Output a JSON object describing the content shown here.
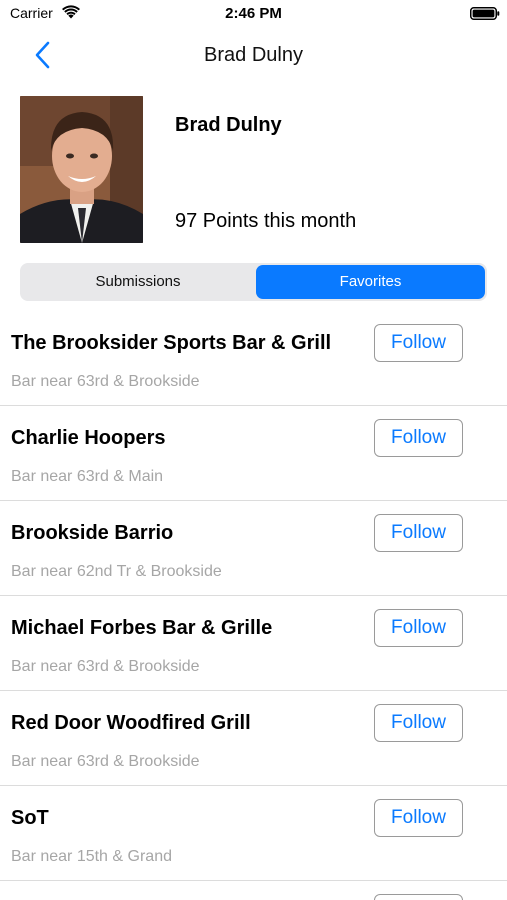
{
  "status_bar": {
    "carrier": "Carrier",
    "time": "2:46 PM"
  },
  "nav": {
    "title": "Brad Dulny"
  },
  "profile": {
    "name": "Brad Dulny",
    "points": "97 Points this month"
  },
  "segments": {
    "submissions": "Submissions",
    "favorites": "Favorites",
    "selected": "Favorites"
  },
  "colors": {
    "accent": "#0a7aff",
    "subtitle": "#a6a6a6",
    "divider": "#dcdcdc"
  },
  "favorites": [
    {
      "title": "The Brooksider Sports Bar & Grill",
      "subtitle": "Bar near 63rd & Brookside",
      "button": "Follow"
    },
    {
      "title": "Charlie Hoopers",
      "subtitle": "Bar near 63rd & Main",
      "button": "Follow"
    },
    {
      "title": "Brookside Barrio",
      "subtitle": "Bar near 62nd Tr & Brookside",
      "button": "Follow"
    },
    {
      "title": "Michael Forbes Bar & Grille",
      "subtitle": "Bar near 63rd & Brookside",
      "button": "Follow"
    },
    {
      "title": "Red Door Woodfired Grill",
      "subtitle": "Bar near 63rd & Brookside",
      "button": "Follow"
    },
    {
      "title": "SoT",
      "subtitle": "Bar near 15th & Grand",
      "button": "Follow"
    }
  ]
}
